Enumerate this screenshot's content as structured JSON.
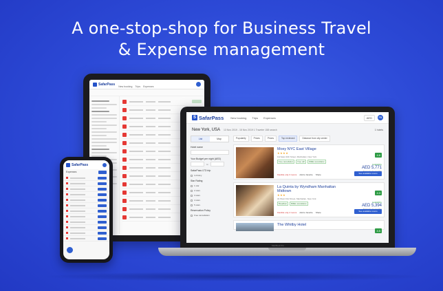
{
  "headline": {
    "line1": "A one-stop-shop for Business Travel",
    "line2": "& Expense management"
  },
  "brand": {
    "name": "SafarPass",
    "logo_letter": "S"
  },
  "laptop": {
    "nav": [
      "New booking",
      "Trips",
      "Expenses"
    ],
    "currency": "AED",
    "avatar": "PB",
    "search": {
      "city": "New York, USA",
      "dates": "13 Nov 2019 - 15 Nov 2019  1 Traveler  158 search",
      "hotels_label": "1 hotels"
    },
    "view_toggle": [
      "List",
      "Map"
    ],
    "filters": {
      "hotel_name": "Hotel name",
      "budget": "Your Budget per night (AED)",
      "budget_to": "to",
      "policy": "SafarPass LTD trip",
      "policy_option": "In Policy",
      "star_rating": "Star Rating",
      "stars": [
        "1 star",
        "2 stars",
        "3 stars",
        "4 stars",
        "5 stars"
      ],
      "reservation_policy": "Reservation Policy",
      "free_cancellation": "Free cancellation"
    },
    "sort_options": [
      "Popularity",
      "Prices",
      "Prices",
      "Top reviewed",
      "Distance from city center"
    ],
    "hotels": [
      {
        "name": "Moxy NYC East Village",
        "stars": "★★★★",
        "address": "112 East 11th Street, Manhattan, New York",
        "tags": [
          "Free cancellation",
          "Free wifi",
          "FREE cancellation"
        ],
        "score": "4.6",
        "availability": "Availability",
        "price": "AED 5,771",
        "per": "Total price for 2 nights",
        "cta": "See available rooms",
        "links": [
          "Flexible only 3 rooms",
          "Add to favorite",
          "Share"
        ]
      },
      {
        "name": "La Quinta by Wyndham Manhattan Midtown",
        "stars": "★★★",
        "address": "31 West 31st Street, Manhattan, New York",
        "tags": [
          "Breakfast",
          "FREE cancellation"
        ],
        "score": "4.3",
        "availability": "Availability",
        "price": "AED 5,394",
        "per": "Total price for 2 nights",
        "cta": "See available rooms",
        "links": [
          "Flexible only 4 rooms",
          "Add to favorite",
          "Share"
        ]
      },
      {
        "name": "The Whitby Hotel",
        "stars": "",
        "address": "",
        "tags": [],
        "score": "4.5",
        "availability": "",
        "price": "",
        "per": "",
        "cta": "",
        "links": []
      }
    ]
  },
  "base_label": "MacBook Pro"
}
